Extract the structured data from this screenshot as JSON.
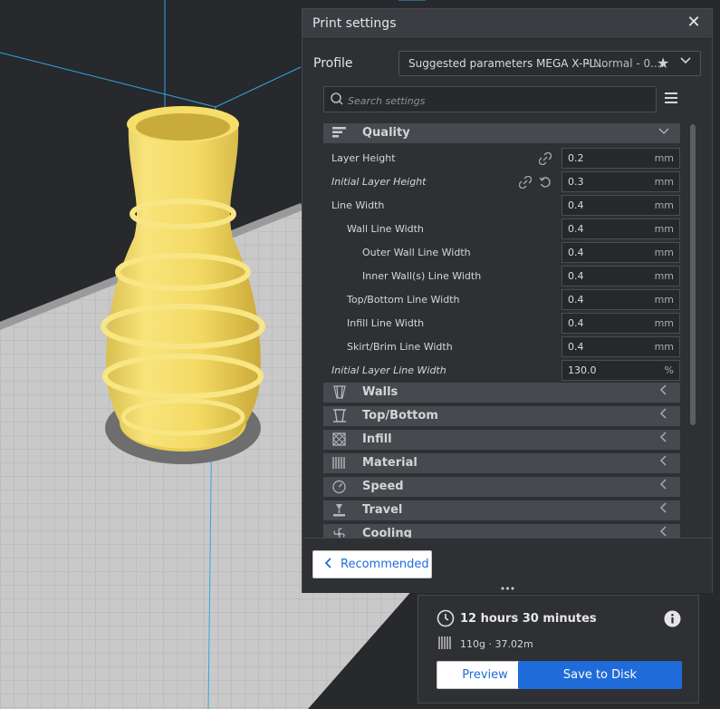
{
  "panel": {
    "title": "Print settings",
    "profile_label": "Profile",
    "profile_name": "Suggested parameters MEGA X-PL...",
    "profile_quality": "- Normal - 0....",
    "search_placeholder": "Search settings",
    "categories": [
      {
        "label": "Quality",
        "expanded": true,
        "icon": "quality-icon"
      },
      {
        "label": "Walls",
        "icon": "walls-icon"
      },
      {
        "label": "Top/Bottom",
        "icon": "top-bottom-icon"
      },
      {
        "label": "Infill",
        "icon": "infill-icon"
      },
      {
        "label": "Material",
        "icon": "material-icon"
      },
      {
        "label": "Speed",
        "icon": "speed-icon"
      },
      {
        "label": "Travel",
        "icon": "travel-icon"
      },
      {
        "label": "Cooling",
        "icon": "cooling-icon"
      }
    ],
    "settings": [
      {
        "label": "Layer Height",
        "value": "0.2",
        "unit": "mm"
      },
      {
        "label": "Initial Layer Height",
        "value": "0.3",
        "unit": "mm"
      },
      {
        "label": "Line Width",
        "value": "0.4",
        "unit": "mm"
      },
      {
        "label": "Wall Line Width",
        "value": "0.4",
        "unit": "mm"
      },
      {
        "label": "Outer Wall Line Width",
        "value": "0.4",
        "unit": "mm"
      },
      {
        "label": "Inner Wall(s) Line Width",
        "value": "0.4",
        "unit": "mm"
      },
      {
        "label": "Top/Bottom Line Width",
        "value": "0.4",
        "unit": "mm"
      },
      {
        "label": "Infill Line Width",
        "value": "0.4",
        "unit": "mm"
      },
      {
        "label": "Skirt/Brim Line Width",
        "value": "0.4",
        "unit": "mm"
      },
      {
        "label": "Initial Layer Line Width",
        "value": "130.0",
        "unit": "%"
      }
    ],
    "recommended_label": "Recommended"
  },
  "job": {
    "time": "12 hours 30 minutes",
    "material": "110g · 37.02m",
    "preview_label": "Preview",
    "save_label": "Save to Disk"
  },
  "colors": {
    "accent": "#1f6bd9",
    "model": "#f5df6a",
    "build_plate": "#c8c8c8",
    "panel_bg": "#2e3034",
    "viewport_bg": "#27292c",
    "volume_lines": "#2fa8e0"
  }
}
